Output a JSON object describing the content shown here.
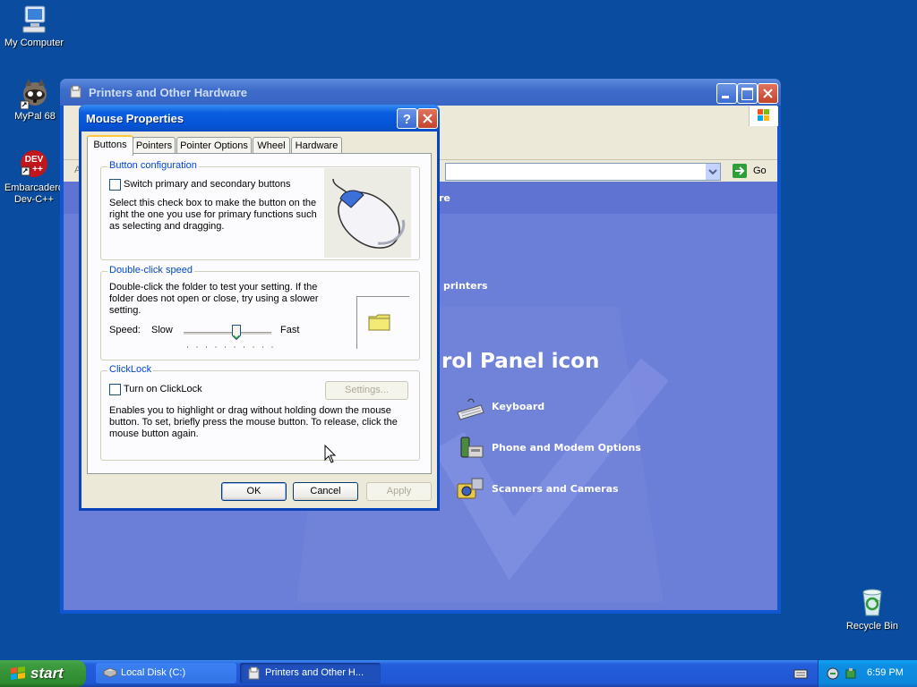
{
  "desktop": {
    "icons": [
      {
        "label": "My Computer",
        "icon": "computer-icon"
      },
      {
        "label": "MyPal 68",
        "icon": "raccoon-browser-icon"
      },
      {
        "label": "Embarcadero Dev-C++",
        "line1": "Embarcadero",
        "line2": "Dev-C++",
        "icon": "devcpp-icon",
        "badge": "DEV",
        "badge2": "++"
      },
      {
        "label": "Recycle Bin",
        "icon": "recycle-bin-icon"
      }
    ]
  },
  "explorer": {
    "title": "Printers and Other Hardware",
    "address_letter": "A",
    "go_label": "Go",
    "header_fragment": "re",
    "task_fragment": "printers",
    "section_heading_fragment": "rol Panel icon",
    "items": [
      {
        "label": "Keyboard",
        "icon": "keyboard-icon"
      },
      {
        "label": "Phone and Modem Options",
        "icon": "phone-icon"
      },
      {
        "label": "Scanners and Cameras",
        "icon": "camera-icon"
      }
    ]
  },
  "dialog": {
    "title": "Mouse Properties",
    "tabs": [
      "Buttons",
      "Pointers",
      "Pointer Options",
      "Wheel",
      "Hardware"
    ],
    "active_tab": "Buttons",
    "button_config": {
      "heading": "Button configuration",
      "checkbox_label": "Switch primary and secondary buttons",
      "checked": false,
      "description_lines": [
        "Select this check box to make the button on the",
        "right the one you use for primary functions such",
        "as selecting and dragging."
      ]
    },
    "double_click": {
      "heading": "Double-click speed",
      "description_lines": [
        "Double-click the folder to test your setting. If the",
        "folder does not open or close, try using a slower",
        "setting."
      ],
      "speed_label": "Speed:",
      "slow_label": "Slow",
      "fast_label": "Fast",
      "slider_value": 0.6
    },
    "clicklock": {
      "heading": "ClickLock",
      "checkbox_label": "Turn on ClickLock",
      "checked": false,
      "settings_label": "Settings...",
      "description_lines": [
        "Enables you to highlight or drag without holding down the mouse",
        "button. To set, briefly press the mouse button. To release, click the",
        "mouse button again."
      ]
    },
    "buttons": {
      "ok": "OK",
      "cancel": "Cancel",
      "apply": "Apply"
    }
  },
  "taskbar": {
    "start_label": "start",
    "tasks": [
      {
        "label": "Local Disk (C:)",
        "icon": "drive-icon"
      },
      {
        "label": "Printers and Other H...",
        "icon": "printer-folder-icon"
      }
    ],
    "clock": "6:59 PM"
  },
  "colors": {
    "desktop": "#0a4da0",
    "dialog_title": "#0553d4",
    "group_label": "#0046d5",
    "content_bg": "#6b7ed8"
  }
}
